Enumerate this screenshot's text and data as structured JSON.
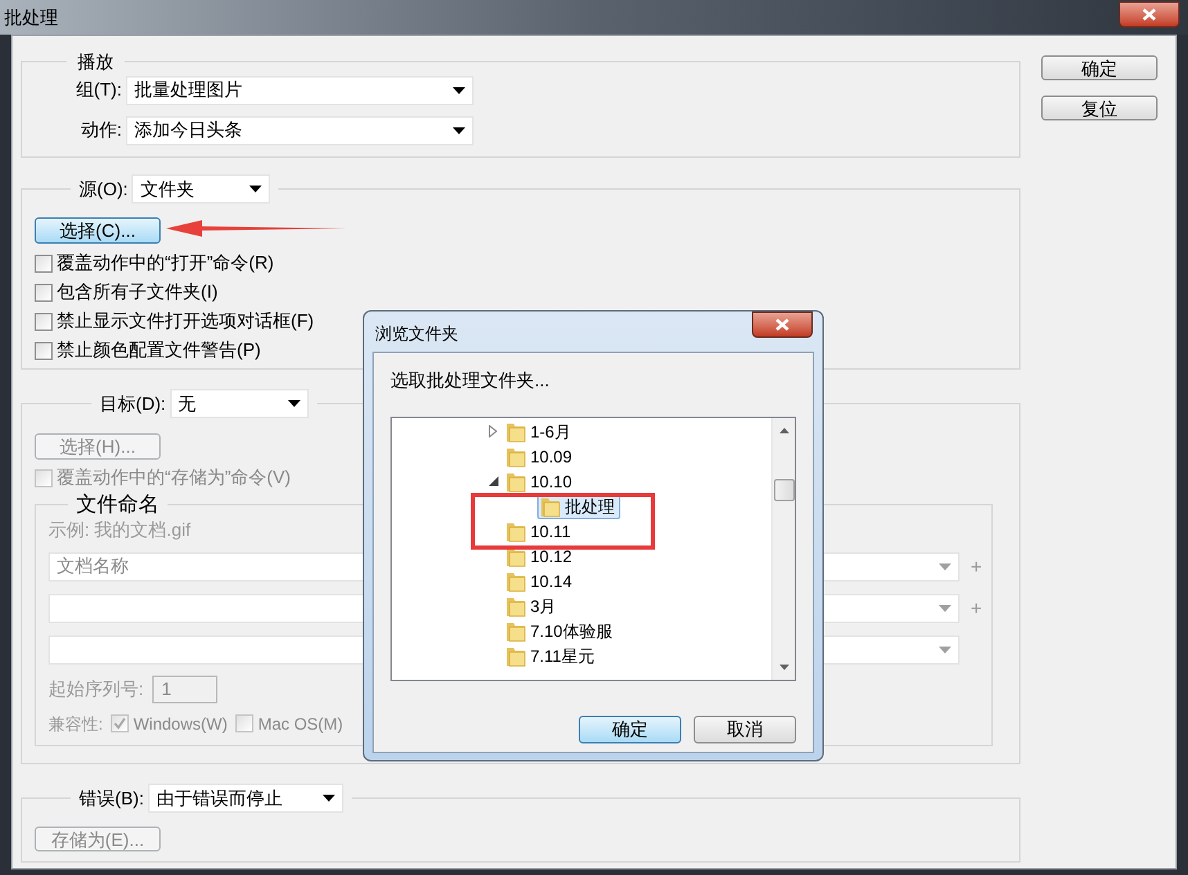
{
  "window": {
    "title": "批处理"
  },
  "play": {
    "title": "播放",
    "group": {
      "label": "组(T):",
      "value": "批量处理图片"
    },
    "action": {
      "label": "动作:",
      "value": "添加今日头条"
    }
  },
  "source": {
    "label": "源(O):",
    "value": "文件夹",
    "choose_button": {
      "label": "选择(C)...",
      "focused": true
    },
    "options": [
      {
        "label": "覆盖动作中的“打开”命令(R)",
        "checked": false
      },
      {
        "label": "包含所有子文件夹(I)",
        "checked": false
      },
      {
        "label": "禁止显示文件打开选项对话框(F)",
        "checked": false
      },
      {
        "label": "禁止颜色配置文件警告(P)",
        "checked": false
      }
    ]
  },
  "target": {
    "label": "目标(D):",
    "value": "无",
    "disabled": true,
    "choose_button": {
      "label": "选择(H)..."
    },
    "override": {
      "label": "覆盖动作中的“存储为”命令(V)",
      "checked": false
    },
    "file_naming": {
      "title": "文件命名",
      "example": "示例: 我的文档.gif",
      "fields": [
        {
          "kind": "dropdown",
          "value": "文档名称",
          "plus": "+"
        },
        {
          "kind": "dropdown",
          "plus": "+"
        },
        {
          "kind": "dropdown"
        }
      ],
      "start_serial": {
        "label": "起始序列号:",
        "value": "1"
      },
      "compatibility": {
        "label": "兼容性:",
        "options": [
          {
            "label": "Windows(W)",
            "checked": true
          },
          {
            "label": "Mac OS(M)",
            "checked": false
          }
        ]
      }
    }
  },
  "errors": {
    "label": "错误(B):",
    "value": "由于错误而停止",
    "save_button": {
      "label": "存储为(E)...",
      "disabled": true
    }
  },
  "buttons": [
    {
      "label": "确定"
    },
    {
      "label": "复位"
    }
  ],
  "browse_dialog": {
    "title": "浏览文件夹",
    "prompt": "选取批处理文件夹...",
    "tree": [
      {
        "label": "1-6月",
        "expanded": false,
        "selected": false
      },
      {
        "label": "10.09",
        "selected": false
      },
      {
        "label": "10.10",
        "expanded": true,
        "selected": false,
        "children": [
          {
            "label": "批处理",
            "selected": true
          }
        ]
      },
      {
        "label": "10.11",
        "selected": false
      },
      {
        "label": "10.12",
        "selected": false
      },
      {
        "label": "10.14",
        "selected": false
      },
      {
        "label": "3月",
        "selected": false
      },
      {
        "label": "7.10体验服",
        "selected": false
      },
      {
        "label": "7.11星元",
        "selected": false
      }
    ],
    "buttons": [
      {
        "label": "确定",
        "default": true
      },
      {
        "label": "取消",
        "default": false
      }
    ]
  }
}
